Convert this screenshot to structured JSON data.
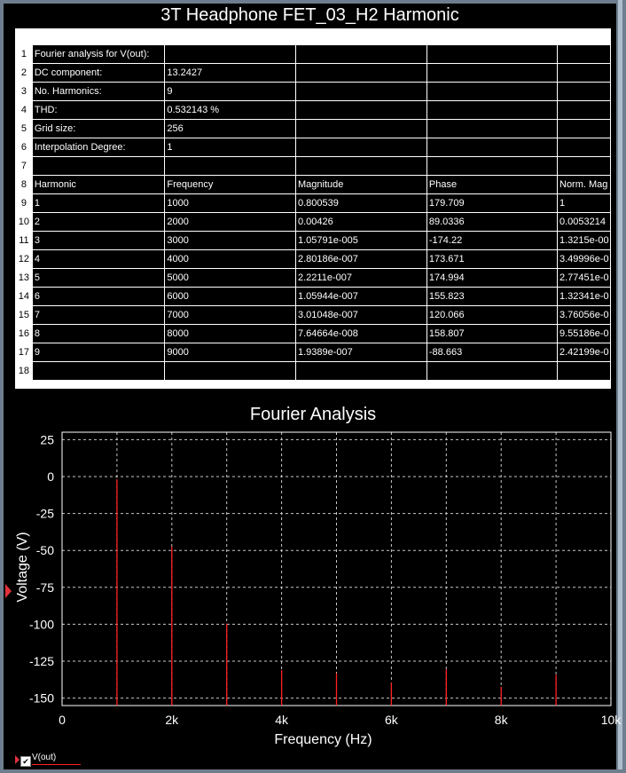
{
  "window": {
    "title": "3T Headphone FET_03_H2 Harmonic"
  },
  "sheet": {
    "row_numbers": [
      "1",
      "2",
      "3",
      "4",
      "5",
      "6",
      "7",
      "8",
      "9",
      "10",
      "11",
      "12",
      "13",
      "14",
      "15",
      "16",
      "17",
      "18"
    ],
    "rows": [
      [
        "Fourier analysis for V(out):",
        "",
        "",
        "",
        ""
      ],
      [
        "DC component:",
        "13.2427",
        "",
        "",
        ""
      ],
      [
        "No. Harmonics:",
        "9",
        "",
        "",
        ""
      ],
      [
        "THD:",
        "0.532143 %",
        "",
        "",
        ""
      ],
      [
        "Grid size:",
        "256",
        "",
        "",
        ""
      ],
      [
        "Interpolation Degree:",
        "1",
        "",
        "",
        ""
      ],
      [
        "",
        "",
        "",
        "",
        ""
      ],
      [
        "Harmonic",
        "Frequency",
        "Magnitude",
        "Phase",
        "Norm. Mag"
      ],
      [
        "1",
        "1000",
        "0.800539",
        "179.709",
        "1"
      ],
      [
        "2",
        "2000",
        "0.00426",
        "89.0336",
        "0.0053214"
      ],
      [
        "3",
        "3000",
        "1.05791e-005",
        "-174.22",
        "1.3215e-00"
      ],
      [
        "4",
        "4000",
        "2.80186e-007",
        "173.671",
        "3.49996e-0"
      ],
      [
        "5",
        "5000",
        "2.2211e-007",
        "174.994",
        "2.77451e-0"
      ],
      [
        "6",
        "6000",
        "1.05944e-007",
        "155.823",
        "1.32341e-0"
      ],
      [
        "7",
        "7000",
        "3.01048e-007",
        "120.066",
        "3.76056e-0"
      ],
      [
        "8",
        "8000",
        "7.64664e-008",
        "158.807",
        "9.55186e-0"
      ],
      [
        "9",
        "9000",
        "1.9389e-007",
        "-88.663",
        "2.42199e-0"
      ],
      [
        "",
        "",
        "",
        "",
        ""
      ]
    ]
  },
  "chart_data": {
    "type": "bar",
    "title": "Fourier Analysis",
    "xlabel": "Frequency (Hz)",
    "ylabel": "Voltage (V)",
    "xlim": [
      0,
      10000
    ],
    "ylim": [
      -155,
      30
    ],
    "x_ticks": [
      0,
      2000,
      4000,
      6000,
      8000,
      10000
    ],
    "x_tick_labels": [
      "0",
      "2k",
      "4k",
      "6k",
      "8k",
      "10k"
    ],
    "y_ticks": [
      25,
      0,
      -25,
      -50,
      -75,
      -100,
      -125,
      -150
    ],
    "y_tick_labels": [
      "25",
      "0",
      "-25",
      "-50",
      "-75",
      "-100",
      "-125",
      "-150"
    ],
    "grid": true,
    "bar_color": "#ff2020",
    "series": [
      {
        "name": "V(out)",
        "x": [
          1000,
          2000,
          3000,
          4000,
          5000,
          6000,
          7000,
          8000,
          9000
        ],
        "values": [
          -1.9,
          -47.4,
          -99.5,
          -131.1,
          -133.1,
          -139.5,
          -130.4,
          -142.3,
          -134.2
        ]
      }
    ],
    "legend": {
      "position": "bottom-left",
      "checked": true
    }
  }
}
